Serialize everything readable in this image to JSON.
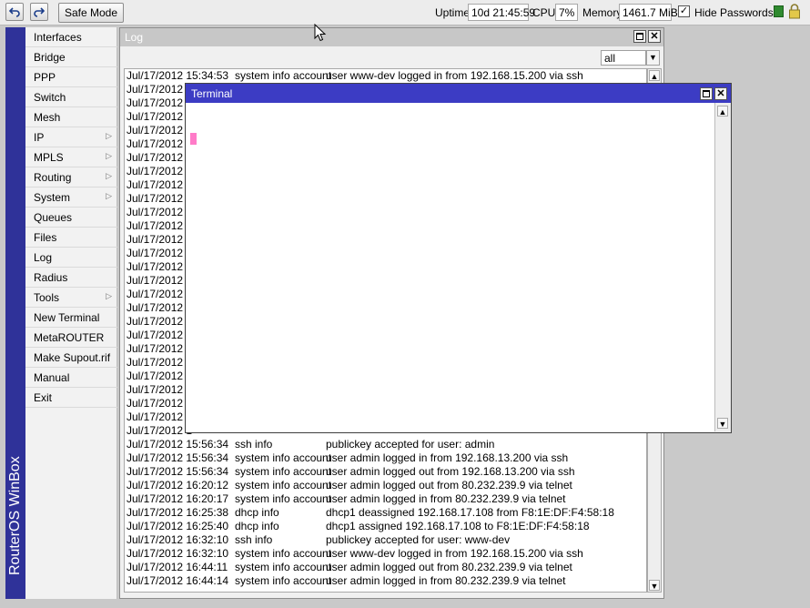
{
  "toolbar": {
    "undo_icon": "undo-icon",
    "redo_icon": "redo-icon",
    "safe_mode_label": "Safe Mode",
    "uptime_label": "Uptime:",
    "uptime_value": "10d 21:45:59",
    "cpu_label": "CPU:",
    "cpu_value": "7%",
    "memory_label": "Memory:",
    "memory_value": "1461.7 MiB",
    "hide_passwords_label": "Hide Passwords",
    "hide_passwords_checked": true,
    "lock_icon": "lock-icon"
  },
  "sidebar": {
    "brand": "RouterOS WinBox",
    "items": [
      {
        "label": "Interfaces",
        "submenu": false
      },
      {
        "label": "Bridge",
        "submenu": false
      },
      {
        "label": "PPP",
        "submenu": false
      },
      {
        "label": "Switch",
        "submenu": false
      },
      {
        "label": "Mesh",
        "submenu": false
      },
      {
        "label": "IP",
        "submenu": true
      },
      {
        "label": "MPLS",
        "submenu": true
      },
      {
        "label": "Routing",
        "submenu": true
      },
      {
        "label": "System",
        "submenu": true
      },
      {
        "label": "Queues",
        "submenu": false
      },
      {
        "label": "Files",
        "submenu": false
      },
      {
        "label": "Log",
        "submenu": false
      },
      {
        "label": "Radius",
        "submenu": false
      },
      {
        "label": "Tools",
        "submenu": true
      },
      {
        "label": "New Terminal",
        "submenu": false
      },
      {
        "label": "MetaROUTER",
        "submenu": false
      },
      {
        "label": "Make Supout.rif",
        "submenu": false
      },
      {
        "label": "Manual",
        "submenu": false
      },
      {
        "label": "Exit",
        "submenu": false
      }
    ]
  },
  "log_window": {
    "title": "Log",
    "filter_value": "all",
    "rows": [
      {
        "time": "Jul/17/2012 15:34:53",
        "topic": "system info account",
        "message": "user www-dev logged in from 192.168.15.200 via ssh"
      },
      {
        "time": "Jul/17/2012 1",
        "topic": "",
        "message": ""
      },
      {
        "time": "Jul/17/2012 1",
        "topic": "",
        "message": ""
      },
      {
        "time": "Jul/17/2012 1",
        "topic": "",
        "message": ""
      },
      {
        "time": "Jul/17/2012 1",
        "topic": "",
        "message": ""
      },
      {
        "time": "Jul/17/2012 1",
        "topic": "",
        "message": ""
      },
      {
        "time": "Jul/17/2012 1",
        "topic": "",
        "message": ""
      },
      {
        "time": "Jul/17/2012 1",
        "topic": "",
        "message": ""
      },
      {
        "time": "Jul/17/2012 1",
        "topic": "",
        "message": ""
      },
      {
        "time": "Jul/17/2012 1",
        "topic": "",
        "message": ""
      },
      {
        "time": "Jul/17/2012 1",
        "topic": "",
        "message": ""
      },
      {
        "time": "Jul/17/2012 1",
        "topic": "",
        "message": ""
      },
      {
        "time": "Jul/17/2012 1",
        "topic": "",
        "message": ""
      },
      {
        "time": "Jul/17/2012 1",
        "topic": "",
        "message": ""
      },
      {
        "time": "Jul/17/2012 1",
        "topic": "",
        "message": ""
      },
      {
        "time": "Jul/17/2012 1",
        "topic": "",
        "message": ""
      },
      {
        "time": "Jul/17/2012 1",
        "topic": "",
        "message": ""
      },
      {
        "time": "Jul/17/2012 1",
        "topic": "",
        "message": ""
      },
      {
        "time": "Jul/17/2012 1",
        "topic": "",
        "message": ""
      },
      {
        "time": "Jul/17/2012 1",
        "topic": "",
        "message": ""
      },
      {
        "time": "Jul/17/2012 1",
        "topic": "",
        "message": ""
      },
      {
        "time": "Jul/17/2012 1",
        "topic": "",
        "message": ""
      },
      {
        "time": "Jul/17/2012 1",
        "topic": "",
        "message": ""
      },
      {
        "time": "Jul/17/2012 1",
        "topic": "",
        "message": ""
      },
      {
        "time": "Jul/17/2012 1",
        "topic": "",
        "message": ""
      },
      {
        "time": "Jul/17/2012 1",
        "topic": "",
        "message": ""
      },
      {
        "time": "Jul/17/2012 1",
        "topic": "",
        "message": ""
      },
      {
        "time": "Jul/17/2012 15:56:34",
        "topic": "ssh info",
        "message": "publickey accepted for user: admin"
      },
      {
        "time": "Jul/17/2012 15:56:34",
        "topic": "system info account",
        "message": "user admin logged in from 192.168.13.200 via ssh"
      },
      {
        "time": "Jul/17/2012 15:56:34",
        "topic": "system info account",
        "message": "user admin logged out from 192.168.13.200 via ssh"
      },
      {
        "time": "Jul/17/2012 16:20:12",
        "topic": "system info account",
        "message": "user admin logged out from 80.232.239.9 via telnet"
      },
      {
        "time": "Jul/17/2012 16:20:17",
        "topic": "system info account",
        "message": "user admin logged in from 80.232.239.9 via telnet"
      },
      {
        "time": "Jul/17/2012 16:25:38",
        "topic": "dhcp info",
        "message": "dhcp1 deassigned 192.168.17.108 from F8:1E:DF:F4:58:18"
      },
      {
        "time": "Jul/17/2012 16:25:40",
        "topic": "dhcp info",
        "message": "dhcp1 assigned 192.168.17.108 to F8:1E:DF:F4:58:18"
      },
      {
        "time": "Jul/17/2012 16:32:10",
        "topic": "ssh info",
        "message": "publickey accepted for user: www-dev"
      },
      {
        "time": "Jul/17/2012 16:32:10",
        "topic": "system info account",
        "message": "user www-dev logged in from 192.168.15.200 via ssh"
      },
      {
        "time": "Jul/17/2012 16:44:11",
        "topic": "system info account",
        "message": "user admin logged out from 80.232.239.9 via telnet"
      },
      {
        "time": "Jul/17/2012 16:44:14",
        "topic": "system info account",
        "message": "user admin logged in from 80.232.239.9 via telnet"
      }
    ]
  },
  "terminal_window": {
    "title": "Terminal"
  },
  "colors": {
    "sidebar_strip": "#2f3299",
    "terminal_title": "#3c3cc4",
    "cursor": "#ff7bc8",
    "log_title_inactive": "#c7c7c7"
  }
}
